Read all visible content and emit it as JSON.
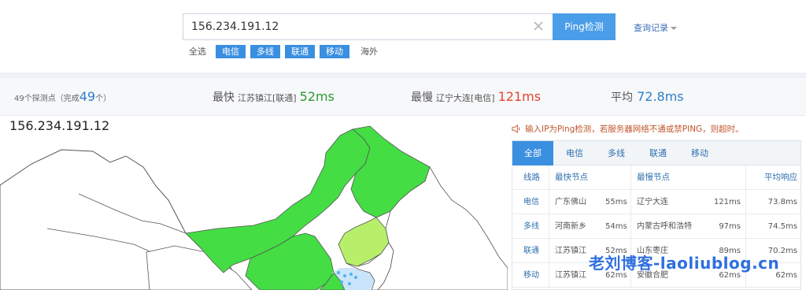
{
  "search": {
    "value": "156.234.191.12",
    "button_label": "Ping检测",
    "history_label": "查询记录"
  },
  "filters": [
    {
      "label": "全选",
      "selected": false
    },
    {
      "label": "电信",
      "selected": true
    },
    {
      "label": "多线",
      "selected": true
    },
    {
      "label": "联通",
      "selected": true
    },
    {
      "label": "移动",
      "selected": true
    },
    {
      "label": "海外",
      "selected": false
    }
  ],
  "stats": {
    "nodes_prefix": "49个探测点（完成",
    "nodes_done": "49",
    "nodes_suffix": "个）",
    "fastest_label": "最快",
    "fastest_location": "江苏镇江[联通]",
    "fastest_value": "52ms",
    "slowest_label": "最慢",
    "slowest_location": "辽宁大连[电信]",
    "slowest_value": "121ms",
    "average_label": "平均",
    "average_value": "72.8ms"
  },
  "map": {
    "ip_title": "156.234.191.12",
    "colors": {
      "fast": "#44dd44",
      "medium": "#b8ef6a",
      "none": "#ffffff",
      "water": "#c9e4fb"
    }
  },
  "notice": "输入IP为Ping检测，若服务器网络不通或禁PING，则超时。",
  "panel": {
    "tabs": [
      "全部",
      "电信",
      "多线",
      "联通",
      "移动"
    ],
    "active_tab": "全部",
    "columns": [
      "线路",
      "最快节点",
      "最慢节点",
      "平均响应"
    ],
    "rows": [
      {
        "line": "电信",
        "fast_node": "广东佛山",
        "fast_ms": "55ms",
        "slow_node": "辽宁大连",
        "slow_ms": "121ms",
        "avg": "73.8ms"
      },
      {
        "line": "多线",
        "fast_node": "河南新乡",
        "fast_ms": "54ms",
        "slow_node": "内蒙古呼和浩特",
        "slow_ms": "97ms",
        "avg": "74.5ms"
      },
      {
        "line": "联通",
        "fast_node": "江苏镇江",
        "fast_ms": "52ms",
        "slow_node": "山东枣庄",
        "slow_ms": "89ms",
        "avg": "70.2ms"
      },
      {
        "line": "移动",
        "fast_node": "江苏镇江",
        "fast_ms": "62ms",
        "slow_node": "安徽合肥",
        "slow_ms": "62ms",
        "avg": "62ms"
      }
    ]
  },
  "watermark": "老刘博客-laoliublog.cn"
}
